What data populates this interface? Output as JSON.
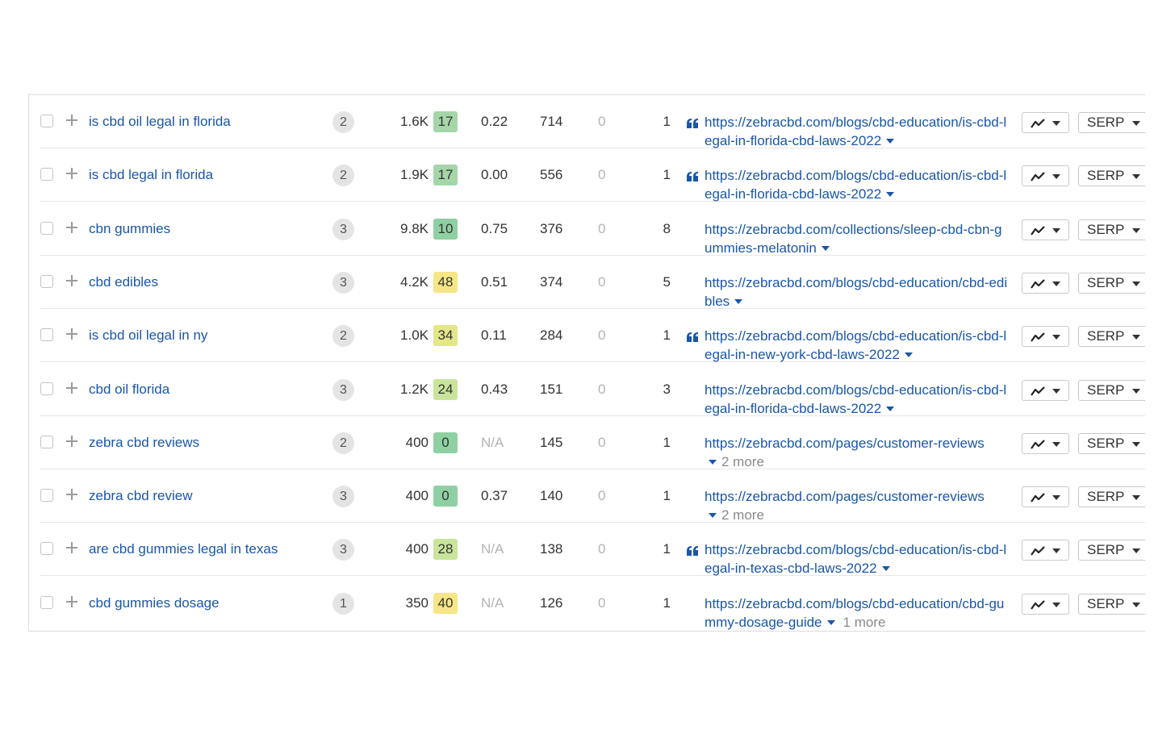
{
  "colors": {
    "kd_green_dark": "#8fd0a3",
    "kd_green_mid": "#a5d6a7",
    "kd_green_light": "#c9e49b",
    "kd_yellow": "#f7e687",
    "kd_yellow_green": "#e5e58a",
    "link": "#1a56a8"
  },
  "icons": {
    "checkbox": "checkbox-icon",
    "add": "plus-icon",
    "featured_snippet": "quote-icon",
    "trend": "trend-chart-icon",
    "dropdown": "chevron-down-icon"
  },
  "rows": [
    {
      "keyword": "is cbd oil legal in florida",
      "serp_features": "2",
      "volume": "1.6K",
      "kd": "17",
      "kd_color": "#a5d6a7",
      "cpc": "0.22",
      "traffic": "714",
      "zero": "0",
      "position": "1",
      "snippet": true,
      "url": "https://zebracbd.com/blogs/cbd-education/is-cbd-legal-in-florida-cbd-laws-2022",
      "more": "",
      "serp_label": "SERP"
    },
    {
      "keyword": "is cbd legal in florida",
      "serp_features": "2",
      "volume": "1.9K",
      "kd": "17",
      "kd_color": "#a5d6a7",
      "cpc": "0.00",
      "traffic": "556",
      "zero": "0",
      "position": "1",
      "snippet": true,
      "url": "https://zebracbd.com/blogs/cbd-education/is-cbd-legal-in-florida-cbd-laws-2022",
      "more": "",
      "serp_label": "SERP"
    },
    {
      "keyword": "cbn gummies",
      "serp_features": "3",
      "volume": "9.8K",
      "kd": "10",
      "kd_color": "#8fd0a3",
      "cpc": "0.75",
      "traffic": "376",
      "zero": "0",
      "position": "8",
      "snippet": false,
      "url": "https://zebracbd.com/collections/sleep-cbd-cbn-gummies-melatonin",
      "more": "",
      "serp_label": "SERP"
    },
    {
      "keyword": "cbd edibles",
      "serp_features": "3",
      "volume": "4.2K",
      "kd": "48",
      "kd_color": "#f7e687",
      "cpc": "0.51",
      "traffic": "374",
      "zero": "0",
      "position": "5",
      "snippet": false,
      "url": "https://zebracbd.com/blogs/cbd-education/cbd-edibles",
      "more": "",
      "serp_label": "SERP"
    },
    {
      "keyword": "is cbd oil legal in ny",
      "serp_features": "2",
      "volume": "1.0K",
      "kd": "34",
      "kd_color": "#e5e58a",
      "cpc": "0.11",
      "traffic": "284",
      "zero": "0",
      "position": "1",
      "snippet": true,
      "url": "https://zebracbd.com/blogs/cbd-education/is-cbd-legal-in-new-york-cbd-laws-2022",
      "more": "",
      "serp_label": "SERP"
    },
    {
      "keyword": "cbd oil florida",
      "serp_features": "3",
      "volume": "1.2K",
      "kd": "24",
      "kd_color": "#c9e49b",
      "cpc": "0.43",
      "traffic": "151",
      "zero": "0",
      "position": "3",
      "snippet": false,
      "url": "https://zebracbd.com/blogs/cbd-education/is-cbd-legal-in-florida-cbd-laws-2022",
      "more": "",
      "serp_label": "SERP"
    },
    {
      "keyword": "zebra cbd reviews",
      "serp_features": "2",
      "volume": "400",
      "kd": "0",
      "kd_color": "#8fd0a3",
      "cpc": "N/A",
      "traffic": "145",
      "zero": "0",
      "position": "1",
      "snippet": false,
      "url": "https://zebracbd.com/pages/customer-reviews",
      "more": "2 more",
      "serp_label": "SERP"
    },
    {
      "keyword": "zebra cbd review",
      "serp_features": "3",
      "volume": "400",
      "kd": "0",
      "kd_color": "#8fd0a3",
      "cpc": "0.37",
      "traffic": "140",
      "zero": "0",
      "position": "1",
      "snippet": false,
      "url": "https://zebracbd.com/pages/customer-reviews",
      "more": "2 more",
      "serp_label": "SERP"
    },
    {
      "keyword": "are cbd gummies legal in texas",
      "serp_features": "3",
      "volume": "400",
      "kd": "28",
      "kd_color": "#c9e49b",
      "cpc": "N/A",
      "traffic": "138",
      "zero": "0",
      "position": "1",
      "snippet": true,
      "url": "https://zebracbd.com/blogs/cbd-education/is-cbd-legal-in-texas-cbd-laws-2022",
      "more": "",
      "serp_label": "SERP"
    },
    {
      "keyword": "cbd gummies dosage",
      "serp_features": "1",
      "volume": "350",
      "kd": "40",
      "kd_color": "#f7e687",
      "cpc": "N/A",
      "traffic": "126",
      "zero": "0",
      "position": "1",
      "snippet": false,
      "url": "https://zebracbd.com/blogs/cbd-education/cbd-gummy-dosage-guide",
      "more": "1 more",
      "serp_label": "SERP"
    }
  ]
}
